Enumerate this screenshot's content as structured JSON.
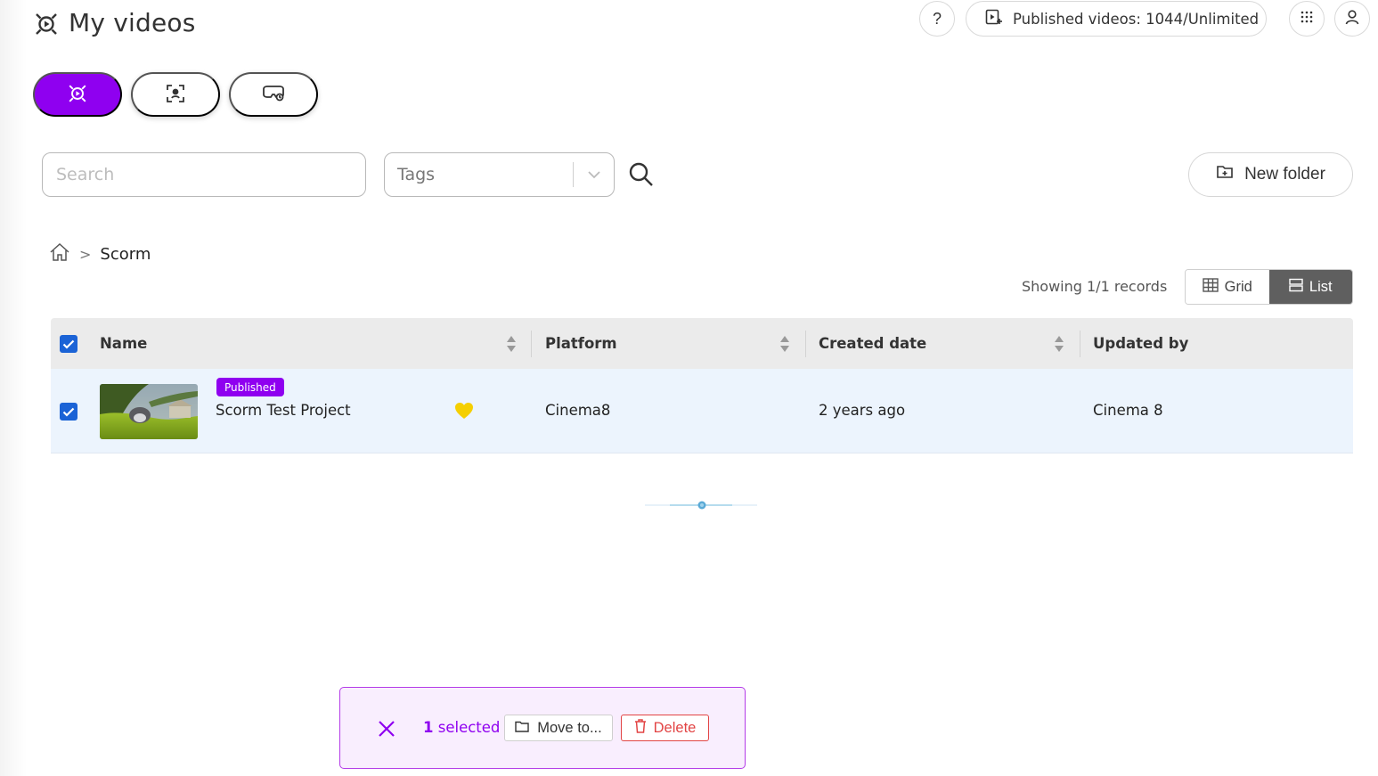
{
  "header": {
    "title": "My videos",
    "published_label": "Published videos: 1044/Unlimited",
    "help_label": "?"
  },
  "search": {
    "placeholder": "Search"
  },
  "tags": {
    "placeholder": "Tags"
  },
  "new_folder": {
    "label": "New folder"
  },
  "breadcrumb": {
    "current": "Scorm"
  },
  "records": {
    "label": "Showing 1/1 records"
  },
  "view_toggle": {
    "grid": "Grid",
    "list": "List",
    "active": "list"
  },
  "table": {
    "columns": [
      "Name",
      "Platform",
      "Created date",
      "Updated by"
    ],
    "rows": [
      {
        "badge": "Published",
        "name": "Scorm Test Project",
        "platform": "Cinema8",
        "created": "2 years ago",
        "updated_by": "Cinema 8",
        "favorite": true,
        "selected": true
      }
    ]
  },
  "selection_bar": {
    "count": "1",
    "count_suffix": "selected",
    "move_label": "Move to...",
    "delete_label": "Delete"
  },
  "colors": {
    "accent": "#8f00f0",
    "checkbox": "#1b63d6",
    "danger": "#e24444",
    "heart": "#f5cf00",
    "row_selected": "#ecf4fd"
  },
  "icons": {
    "title": "video-reel-icon",
    "published": "video-upload-icon",
    "apps": "grid-dots-icon",
    "user": "user-icon",
    "mode_1": "video-reel-icon",
    "mode_2": "focus-scan-icon",
    "mode_3": "vr-headset-icon",
    "search": "magnifier-icon",
    "new_folder": "folder-plus-icon",
    "home": "home-icon"
  }
}
